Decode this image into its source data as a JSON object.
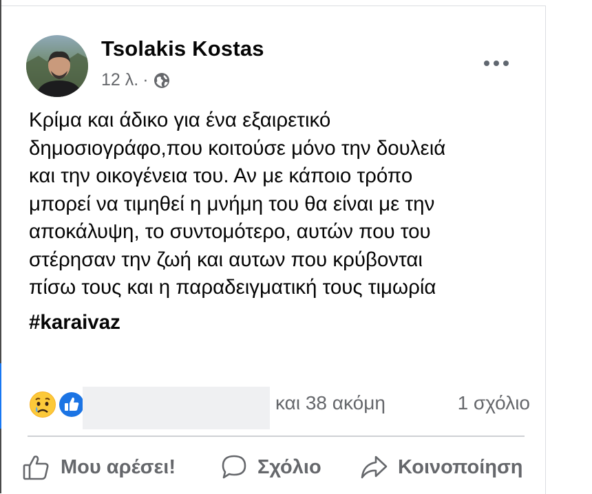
{
  "post": {
    "author": "Tsolakis Kostas",
    "time": "12 λ.",
    "separator": "·",
    "privacy_icon": "globe-icon",
    "menu_icon": "more-options-icon",
    "text": "Κρίμα και άδικο για ένα εξαιρετικό\nδημοσιογράφο,που κοιτούσε μόνο την δουλειά\nκαι την οικογένεια του. Αν με κάποιο τρόπο\nμπορεί να τιμηθεί η μνήμη του θα είναι με την\nαποκάλυψη, το συντομότερο, αυτών που του\nστέρησαν την ζωή και αυτων που κρύβονται\nπίσω τους και η παραδειγματική τους τιμωρία",
    "hashtag": "#karaivaz"
  },
  "reactions": {
    "icons": [
      "sad-reaction-icon",
      "like-reaction-icon"
    ],
    "others": "και 38 ακόμη",
    "comments": "1 σχόλιο"
  },
  "actions": {
    "like": "Μου αρέσει!",
    "comment": "Σχόλιο",
    "share": "Κοινοποίηση"
  },
  "colors": {
    "text": "#050505",
    "secondary": "#65676b",
    "accent": "#1877f2",
    "divider": "#ced0d4"
  }
}
